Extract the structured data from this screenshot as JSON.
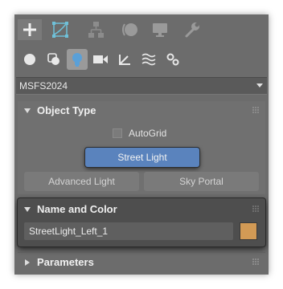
{
  "dropdown": {
    "value": "MSFS2024"
  },
  "object_type": {
    "title": "Object Type",
    "autogrid_label": "AutoGrid",
    "autogrid_checked": false,
    "buttons": {
      "street_light": "Street Light",
      "advanced_light": "Advanced Light",
      "sky_portal": "Sky Portal"
    }
  },
  "name_and_color": {
    "title": "Name and Color",
    "name_value": "StreetLight_Left_1",
    "color": "#d29a55"
  },
  "parameters": {
    "title": "Parameters"
  },
  "colors": {
    "panel": "#6c6c6c",
    "selected_button": "#5a83bd",
    "accent_icon": "#5aa0d8"
  }
}
